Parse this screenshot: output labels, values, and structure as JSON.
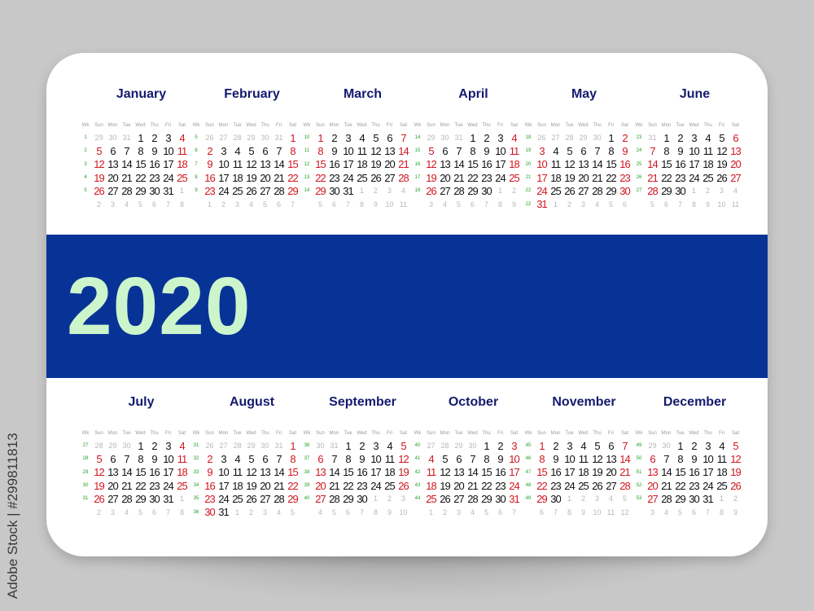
{
  "year": "2020",
  "watermark": "Adobe Stock | #299811813",
  "colors": {
    "band": "#083396",
    "year_text": "#ccf5cc",
    "month_title": "#141a6e",
    "weekend": "#d2151f",
    "week_number": "#22a022",
    "other_month": "#b8b8b8"
  },
  "weekday_header": [
    "Wk",
    "Sun",
    "Mon",
    "Tue",
    "Wed",
    "Thu",
    "Fri",
    "Sat"
  ],
  "months": [
    {
      "name": "January",
      "weeks": [
        {
          "wk": "1",
          "days": [
            "29",
            "30",
            "31",
            "1",
            "2",
            "3",
            "4"
          ],
          "other": [
            0,
            1,
            2
          ]
        },
        {
          "wk": "2",
          "days": [
            "5",
            "6",
            "7",
            "8",
            "9",
            "10",
            "11"
          ],
          "other": []
        },
        {
          "wk": "3",
          "days": [
            "12",
            "13",
            "14",
            "15",
            "16",
            "17",
            "18"
          ],
          "other": []
        },
        {
          "wk": "4",
          "days": [
            "19",
            "20",
            "21",
            "22",
            "23",
            "24",
            "25"
          ],
          "other": []
        },
        {
          "wk": "5",
          "days": [
            "26",
            "27",
            "28",
            "29",
            "30",
            "31",
            "1"
          ],
          "other": [
            6
          ]
        },
        {
          "wk": "",
          "days": [
            "2",
            "3",
            "4",
            "5",
            "6",
            "7",
            "8"
          ],
          "other": [
            0,
            1,
            2,
            3,
            4,
            5,
            6
          ]
        }
      ]
    },
    {
      "name": "February",
      "weeks": [
        {
          "wk": "5",
          "days": [
            "26",
            "27",
            "28",
            "29",
            "30",
            "31",
            "1"
          ],
          "other": [
            0,
            1,
            2,
            3,
            4,
            5
          ]
        },
        {
          "wk": "6",
          "days": [
            "2",
            "3",
            "4",
            "5",
            "6",
            "7",
            "8"
          ],
          "other": []
        },
        {
          "wk": "7",
          "days": [
            "9",
            "10",
            "11",
            "12",
            "13",
            "14",
            "15"
          ],
          "other": []
        },
        {
          "wk": "8",
          "days": [
            "16",
            "17",
            "18",
            "19",
            "20",
            "21",
            "22"
          ],
          "other": []
        },
        {
          "wk": "9",
          "days": [
            "23",
            "24",
            "25",
            "26",
            "27",
            "28",
            "29"
          ],
          "other": []
        },
        {
          "wk": "",
          "days": [
            "1",
            "2",
            "3",
            "4",
            "5",
            "6",
            "7"
          ],
          "other": [
            0,
            1,
            2,
            3,
            4,
            5,
            6
          ]
        }
      ]
    },
    {
      "name": "March",
      "weeks": [
        {
          "wk": "10",
          "days": [
            "1",
            "2",
            "3",
            "4",
            "5",
            "6",
            "7"
          ],
          "other": []
        },
        {
          "wk": "11",
          "days": [
            "8",
            "9",
            "10",
            "11",
            "12",
            "13",
            "14"
          ],
          "other": []
        },
        {
          "wk": "12",
          "days": [
            "15",
            "16",
            "17",
            "18",
            "19",
            "20",
            "21"
          ],
          "other": []
        },
        {
          "wk": "13",
          "days": [
            "22",
            "23",
            "24",
            "25",
            "26",
            "27",
            "28"
          ],
          "other": []
        },
        {
          "wk": "14",
          "days": [
            "29",
            "30",
            "31",
            "1",
            "2",
            "3",
            "4"
          ],
          "other": [
            3,
            4,
            5,
            6
          ]
        },
        {
          "wk": "",
          "days": [
            "5",
            "6",
            "7",
            "8",
            "9",
            "10",
            "11"
          ],
          "other": [
            0,
            1,
            2,
            3,
            4,
            5,
            6
          ]
        }
      ]
    },
    {
      "name": "April",
      "weeks": [
        {
          "wk": "14",
          "days": [
            "29",
            "30",
            "31",
            "1",
            "2",
            "3",
            "4"
          ],
          "other": [
            0,
            1,
            2
          ]
        },
        {
          "wk": "15",
          "days": [
            "5",
            "6",
            "7",
            "8",
            "9",
            "10",
            "11"
          ],
          "other": []
        },
        {
          "wk": "16",
          "days": [
            "12",
            "13",
            "14",
            "15",
            "16",
            "17",
            "18"
          ],
          "other": []
        },
        {
          "wk": "17",
          "days": [
            "19",
            "20",
            "21",
            "22",
            "23",
            "24",
            "25"
          ],
          "other": []
        },
        {
          "wk": "18",
          "days": [
            "26",
            "27",
            "28",
            "29",
            "30",
            "1",
            "2"
          ],
          "other": [
            5,
            6
          ]
        },
        {
          "wk": "",
          "days": [
            "3",
            "4",
            "5",
            "6",
            "7",
            "8",
            "9"
          ],
          "other": [
            0,
            1,
            2,
            3,
            4,
            5,
            6
          ]
        }
      ]
    },
    {
      "name": "May",
      "weeks": [
        {
          "wk": "18",
          "days": [
            "26",
            "27",
            "28",
            "29",
            "30",
            "1",
            "2"
          ],
          "other": [
            0,
            1,
            2,
            3,
            4
          ]
        },
        {
          "wk": "19",
          "days": [
            "3",
            "4",
            "5",
            "6",
            "7",
            "8",
            "9"
          ],
          "other": []
        },
        {
          "wk": "20",
          "days": [
            "10",
            "11",
            "12",
            "13",
            "14",
            "15",
            "16"
          ],
          "other": []
        },
        {
          "wk": "21",
          "days": [
            "17",
            "18",
            "19",
            "20",
            "21",
            "22",
            "23"
          ],
          "other": []
        },
        {
          "wk": "22",
          "days": [
            "24",
            "25",
            "26",
            "27",
            "28",
            "29",
            "30"
          ],
          "other": []
        },
        {
          "wk": "22",
          "days": [
            "31",
            "1",
            "2",
            "3",
            "4",
            "5",
            "6"
          ],
          "other": [
            1,
            2,
            3,
            4,
            5,
            6
          ]
        }
      ]
    },
    {
      "name": "June",
      "weeks": [
        {
          "wk": "23",
          "days": [
            "31",
            "1",
            "2",
            "3",
            "4",
            "5",
            "6"
          ],
          "other": [
            0
          ]
        },
        {
          "wk": "24",
          "days": [
            "7",
            "8",
            "9",
            "10",
            "11",
            "12",
            "13"
          ],
          "other": []
        },
        {
          "wk": "25",
          "days": [
            "14",
            "15",
            "16",
            "17",
            "18",
            "19",
            "20"
          ],
          "other": []
        },
        {
          "wk": "26",
          "days": [
            "21",
            "22",
            "23",
            "24",
            "25",
            "26",
            "27"
          ],
          "other": []
        },
        {
          "wk": "27",
          "days": [
            "28",
            "29",
            "30",
            "1",
            "2",
            "3",
            "4"
          ],
          "other": [
            3,
            4,
            5,
            6
          ]
        },
        {
          "wk": "",
          "days": [
            "5",
            "6",
            "7",
            "8",
            "9",
            "10",
            "11"
          ],
          "other": [
            0,
            1,
            2,
            3,
            4,
            5,
            6
          ]
        }
      ]
    },
    {
      "name": "July",
      "weeks": [
        {
          "wk": "27",
          "days": [
            "28",
            "29",
            "30",
            "1",
            "2",
            "3",
            "4"
          ],
          "other": [
            0,
            1,
            2
          ]
        },
        {
          "wk": "28",
          "days": [
            "5",
            "6",
            "7",
            "8",
            "9",
            "10",
            "11"
          ],
          "other": []
        },
        {
          "wk": "29",
          "days": [
            "12",
            "13",
            "14",
            "15",
            "16",
            "17",
            "18"
          ],
          "other": []
        },
        {
          "wk": "30",
          "days": [
            "19",
            "20",
            "21",
            "22",
            "23",
            "24",
            "25"
          ],
          "other": []
        },
        {
          "wk": "31",
          "days": [
            "26",
            "27",
            "28",
            "29",
            "30",
            "31",
            "1"
          ],
          "other": [
            6
          ]
        },
        {
          "wk": "",
          "days": [
            "2",
            "3",
            "4",
            "5",
            "6",
            "7",
            "8"
          ],
          "other": [
            0,
            1,
            2,
            3,
            4,
            5,
            6
          ]
        }
      ]
    },
    {
      "name": "August",
      "weeks": [
        {
          "wk": "31",
          "days": [
            "26",
            "27",
            "28",
            "29",
            "30",
            "31",
            "1"
          ],
          "other": [
            0,
            1,
            2,
            3,
            4,
            5
          ]
        },
        {
          "wk": "32",
          "days": [
            "2",
            "3",
            "4",
            "5",
            "6",
            "7",
            "8"
          ],
          "other": []
        },
        {
          "wk": "33",
          "days": [
            "9",
            "10",
            "11",
            "12",
            "13",
            "14",
            "15"
          ],
          "other": []
        },
        {
          "wk": "34",
          "days": [
            "16",
            "17",
            "18",
            "19",
            "20",
            "21",
            "22"
          ],
          "other": []
        },
        {
          "wk": "35",
          "days": [
            "23",
            "24",
            "25",
            "26",
            "27",
            "28",
            "29"
          ],
          "other": []
        },
        {
          "wk": "36",
          "days": [
            "30",
            "31",
            "1",
            "2",
            "3",
            "4",
            "5"
          ],
          "other": [
            2,
            3,
            4,
            5,
            6
          ]
        }
      ]
    },
    {
      "name": "September",
      "weeks": [
        {
          "wk": "36",
          "days": [
            "30",
            "31",
            "1",
            "2",
            "3",
            "4",
            "5"
          ],
          "other": [
            0,
            1
          ]
        },
        {
          "wk": "37",
          "days": [
            "6",
            "7",
            "8",
            "9",
            "10",
            "11",
            "12"
          ],
          "other": []
        },
        {
          "wk": "38",
          "days": [
            "13",
            "14",
            "15",
            "16",
            "17",
            "18",
            "19"
          ],
          "other": []
        },
        {
          "wk": "39",
          "days": [
            "20",
            "21",
            "22",
            "23",
            "24",
            "25",
            "26"
          ],
          "other": []
        },
        {
          "wk": "40",
          "days": [
            "27",
            "28",
            "29",
            "30",
            "1",
            "2",
            "3"
          ],
          "other": [
            4,
            5,
            6
          ]
        },
        {
          "wk": "",
          "days": [
            "4",
            "5",
            "6",
            "7",
            "8",
            "9",
            "10"
          ],
          "other": [
            0,
            1,
            2,
            3,
            4,
            5,
            6
          ]
        }
      ]
    },
    {
      "name": "October",
      "weeks": [
        {
          "wk": "40",
          "days": [
            "27",
            "28",
            "29",
            "30",
            "1",
            "2",
            "3"
          ],
          "other": [
            0,
            1,
            2,
            3
          ]
        },
        {
          "wk": "41",
          "days": [
            "4",
            "5",
            "6",
            "7",
            "8",
            "9",
            "10"
          ],
          "other": []
        },
        {
          "wk": "42",
          "days": [
            "11",
            "12",
            "13",
            "14",
            "15",
            "16",
            "17"
          ],
          "other": []
        },
        {
          "wk": "43",
          "days": [
            "18",
            "19",
            "20",
            "21",
            "22",
            "23",
            "24"
          ],
          "other": []
        },
        {
          "wk": "44",
          "days": [
            "25",
            "26",
            "27",
            "28",
            "29",
            "30",
            "31"
          ],
          "other": []
        },
        {
          "wk": "",
          "days": [
            "1",
            "2",
            "3",
            "4",
            "5",
            "6",
            "7"
          ],
          "other": [
            0,
            1,
            2,
            3,
            4,
            5,
            6
          ]
        }
      ]
    },
    {
      "name": "November",
      "weeks": [
        {
          "wk": "45",
          "days": [
            "1",
            "2",
            "3",
            "4",
            "5",
            "6",
            "7"
          ],
          "other": []
        },
        {
          "wk": "46",
          "days": [
            "8",
            "9",
            "10",
            "11",
            "12",
            "13",
            "14"
          ],
          "other": []
        },
        {
          "wk": "47",
          "days": [
            "15",
            "16",
            "17",
            "18",
            "19",
            "20",
            "21"
          ],
          "other": []
        },
        {
          "wk": "48",
          "days": [
            "22",
            "23",
            "24",
            "25",
            "26",
            "27",
            "28"
          ],
          "other": []
        },
        {
          "wk": "49",
          "days": [
            "29",
            "30",
            "1",
            "2",
            "3",
            "4",
            "5"
          ],
          "other": [
            2,
            3,
            4,
            5,
            6
          ]
        },
        {
          "wk": "",
          "days": [
            "6",
            "7",
            "8",
            "9",
            "10",
            "11",
            "12"
          ],
          "other": [
            0,
            1,
            2,
            3,
            4,
            5,
            6
          ]
        }
      ]
    },
    {
      "name": "December",
      "weeks": [
        {
          "wk": "49",
          "days": [
            "29",
            "30",
            "1",
            "2",
            "3",
            "4",
            "5"
          ],
          "other": [
            0,
            1
          ]
        },
        {
          "wk": "50",
          "days": [
            "6",
            "7",
            "8",
            "9",
            "10",
            "11",
            "12"
          ],
          "other": []
        },
        {
          "wk": "51",
          "days": [
            "13",
            "14",
            "15",
            "16",
            "17",
            "18",
            "19"
          ],
          "other": []
        },
        {
          "wk": "52",
          "days": [
            "20",
            "21",
            "22",
            "23",
            "24",
            "25",
            "26"
          ],
          "other": []
        },
        {
          "wk": "53",
          "days": [
            "27",
            "28",
            "29",
            "30",
            "31",
            "1",
            "2"
          ],
          "other": [
            5,
            6
          ]
        },
        {
          "wk": "",
          "days": [
            "3",
            "4",
            "5",
            "6",
            "7",
            "8",
            "9"
          ],
          "other": [
            0,
            1,
            2,
            3,
            4,
            5,
            6
          ]
        }
      ]
    }
  ]
}
